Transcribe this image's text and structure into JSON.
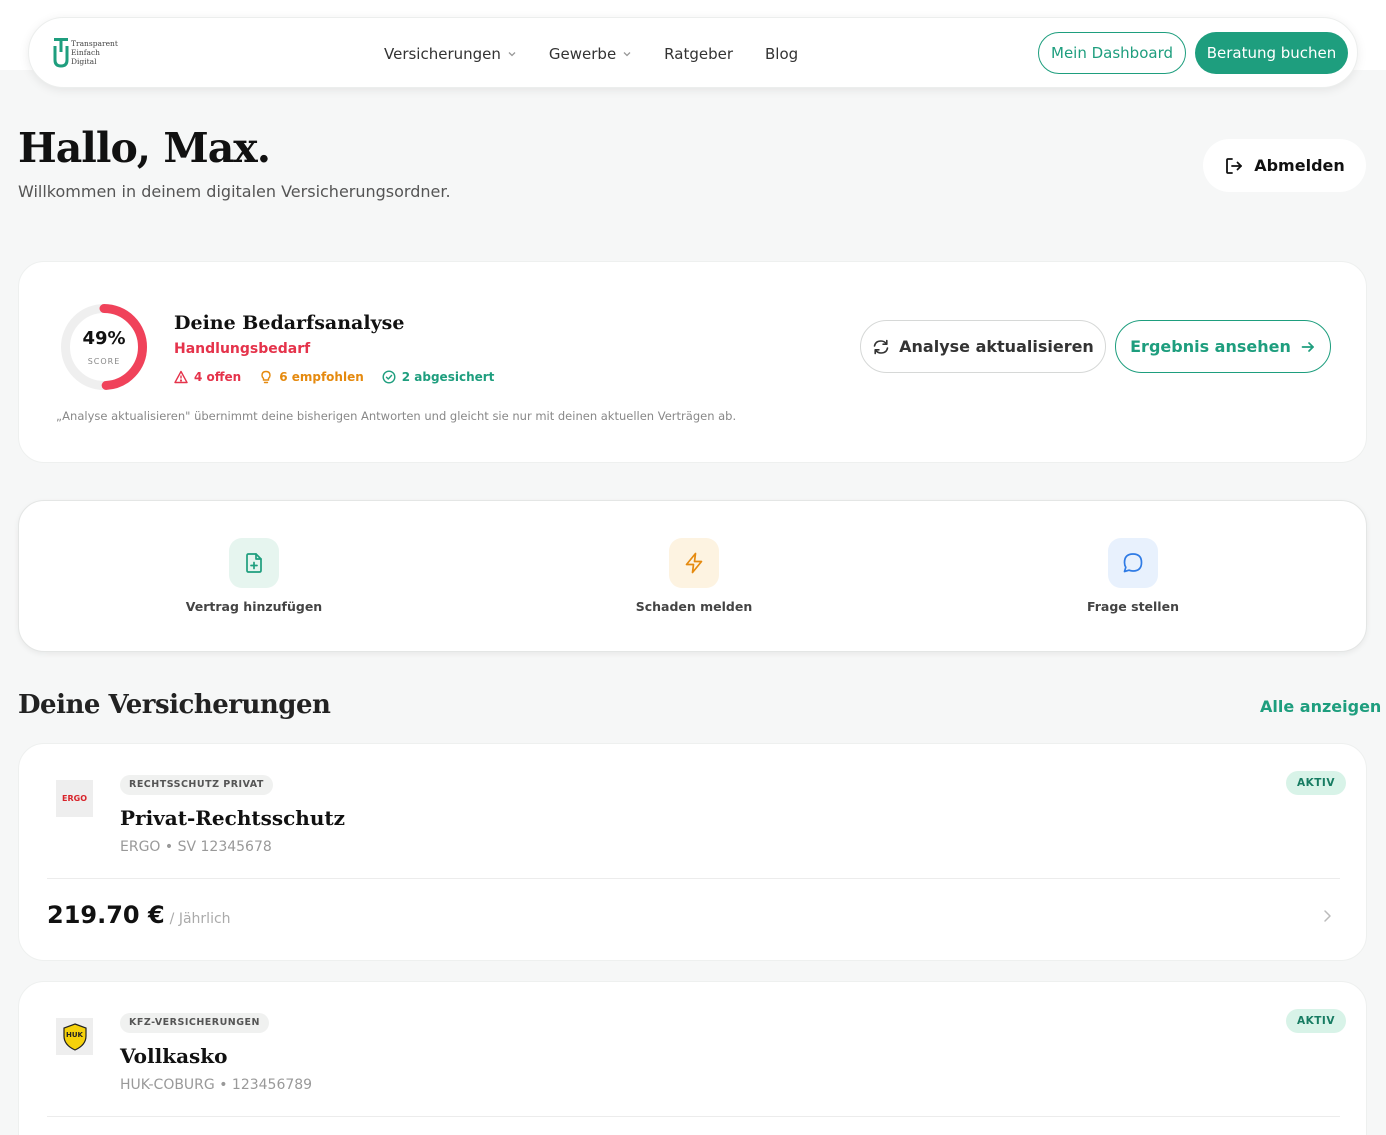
{
  "nav": {
    "logo_lines": [
      "Transparent",
      "Einfach",
      "Digital"
    ],
    "links": [
      {
        "label": "Versicherungen",
        "dropdown": true
      },
      {
        "label": "Gewerbe",
        "dropdown": true
      },
      {
        "label": "Ratgeber",
        "dropdown": false
      },
      {
        "label": "Blog",
        "dropdown": false
      }
    ],
    "dashboard_label": "Mein Dashboard",
    "consult_label": "Beratung buchen"
  },
  "header": {
    "greeting": "Hallo, Max.",
    "subtitle": "Willkommen in deinem digitalen Versicherungsordner.",
    "logout_label": "Abmelden"
  },
  "analysis": {
    "score_percent": 49,
    "score_text": "49%",
    "score_label": "SCORE",
    "title": "Deine Bedarfsanalyse",
    "status": "Handlungsbedarf",
    "stats": {
      "open": "4 offen",
      "recommended": "6 empfohlen",
      "secured": "2 abgesichert"
    },
    "note": "„Analyse aktualisieren\" übernimmt deine bisherigen Antworten und gleicht sie nur mit deinen aktuellen Verträgen ab.",
    "refresh_label": "Analyse aktualisieren",
    "result_label": "Ergebnis ansehen"
  },
  "quick_actions": [
    {
      "label": "Vertrag hinzufügen",
      "icon": "file-plus-icon"
    },
    {
      "label": "Schaden melden",
      "icon": "lightning-icon"
    },
    {
      "label": "Frage stellen",
      "icon": "chat-bubble-icon"
    }
  ],
  "insurances_section": {
    "title": "Deine Versicherungen",
    "see_all_label": "Alle anzeigen"
  },
  "insurances": [
    {
      "logo_text": "ERGO",
      "category": "RECHTSSCHUTZ PRIVAT",
      "name": "Privat-Rechtsschutz",
      "meta": "ERGO • SV 12345678",
      "status": "AKTIV",
      "price": "219.70 €",
      "period": "/ Jährlich"
    },
    {
      "logo_text": "HUK",
      "category": "KFZ-VERSICHERUNGEN",
      "name": "Vollkasko",
      "meta": "HUK-COBURG • 123456789",
      "status": "AKTIV"
    }
  ],
  "colors": {
    "brand": "#1e9e7e",
    "alert": "#e5334b",
    "warning": "#e58a0f"
  }
}
